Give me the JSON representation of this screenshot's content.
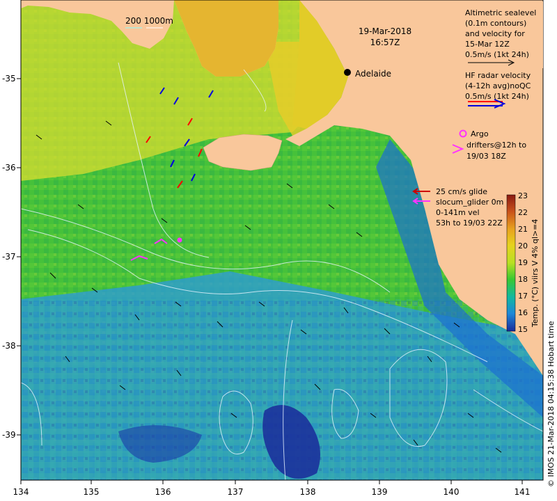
{
  "map": {
    "date": "19-Mar-2018",
    "time": "16:57Z",
    "place_label": "Adelaide",
    "depth_contours_label": "200  1000m",
    "credit": "© IMOS 21-Mar-2018 04:15:38 Hobart time",
    "x_ticks": [
      "134",
      "135",
      "136",
      "137",
      "138",
      "139",
      "140",
      "141"
    ],
    "y_ticks": [
      "-35",
      "-36",
      "-37",
      "-38",
      "-39"
    ]
  },
  "legend": {
    "altimetry": [
      "Altimetric sealevel",
      "(0.1m contours)",
      "and velocity for",
      "15-Mar 12Z",
      "0.5m/s (1kt 24h)"
    ],
    "hf_radar": [
      "HF radar velocity",
      "(4-12h avg)noQC",
      "0.5m/s (1kt 24h)"
    ],
    "argo": [
      "Argo",
      "drifters@12h to",
      "19/03 18Z"
    ],
    "glider": [
      "25 cm/s glide",
      "slocum_glider 0m",
      "0-141m vel",
      "53h to 19/03 22Z"
    ]
  },
  "colorbar": {
    "title": "Temp. (°C) viirs V 4% ql>=4",
    "ticks": [
      "23",
      "22",
      "21",
      "20",
      "19",
      "18",
      "17",
      "16",
      "15"
    ],
    "colors": [
      "#8a1a12",
      "#c8501a",
      "#e8a21e",
      "#e6d21e",
      "#b8e022",
      "#38c832",
      "#12b8a0",
      "#1e88d8",
      "#1a2a9a"
    ]
  },
  "colors": {
    "land": "#f9c79b",
    "shelf_sst": "#6ed23a",
    "warm_sst": "#e3dc32",
    "cool_sst": "#2f8fd8",
    "argo": "#ff33ff",
    "hf_red": "#ff0000",
    "hf_blue": "#0000dd"
  }
}
